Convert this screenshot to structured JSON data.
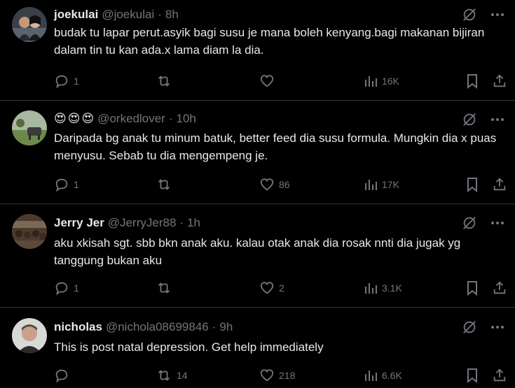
{
  "posts": [
    {
      "name": "joekulai",
      "handle": "@joekulai",
      "sep": "·",
      "time": "8h",
      "text": "budak tu lapar perut.asyik bagi susu je mana boleh kenyang.bagi makanan bijiran dalam tin tu kan ada.x lama diam la dia.",
      "replies": "1",
      "reposts": "",
      "likes": "",
      "views": "16K"
    },
    {
      "name": "",
      "emoji": [
        "😍",
        "😍",
        "😍"
      ],
      "handle": "@orkedlover",
      "sep": "·",
      "time": "10h",
      "text": "Daripada bg anak tu minum batuk, better feed dia susu formula. Mungkin dia x puas menyusu. Sebab tu dia mengempeng je.",
      "replies": "1",
      "reposts": "",
      "likes": "86",
      "views": "17K"
    },
    {
      "name": "Jerry Jer",
      "handle": "@JerryJer88",
      "sep": "·",
      "time": "1h",
      "text": "aku xkisah sgt. sbb bkn anak aku. kalau otak anak dia rosak nnti dia jugak yg tanggung bukan aku",
      "replies": "1",
      "reposts": "",
      "likes": "2",
      "views": "3.1K"
    },
    {
      "name": "nicholas",
      "handle": "@nichola08699846",
      "sep": "·",
      "time": "9h",
      "text": "This is post natal depression. Get help immediately",
      "replies": "",
      "reposts": "14",
      "likes": "218",
      "views": "6.6K"
    }
  ],
  "colors": {
    "background": "#000000",
    "text": "#e7e9ea",
    "muted": "#71767b",
    "divider": "#2f3336"
  }
}
